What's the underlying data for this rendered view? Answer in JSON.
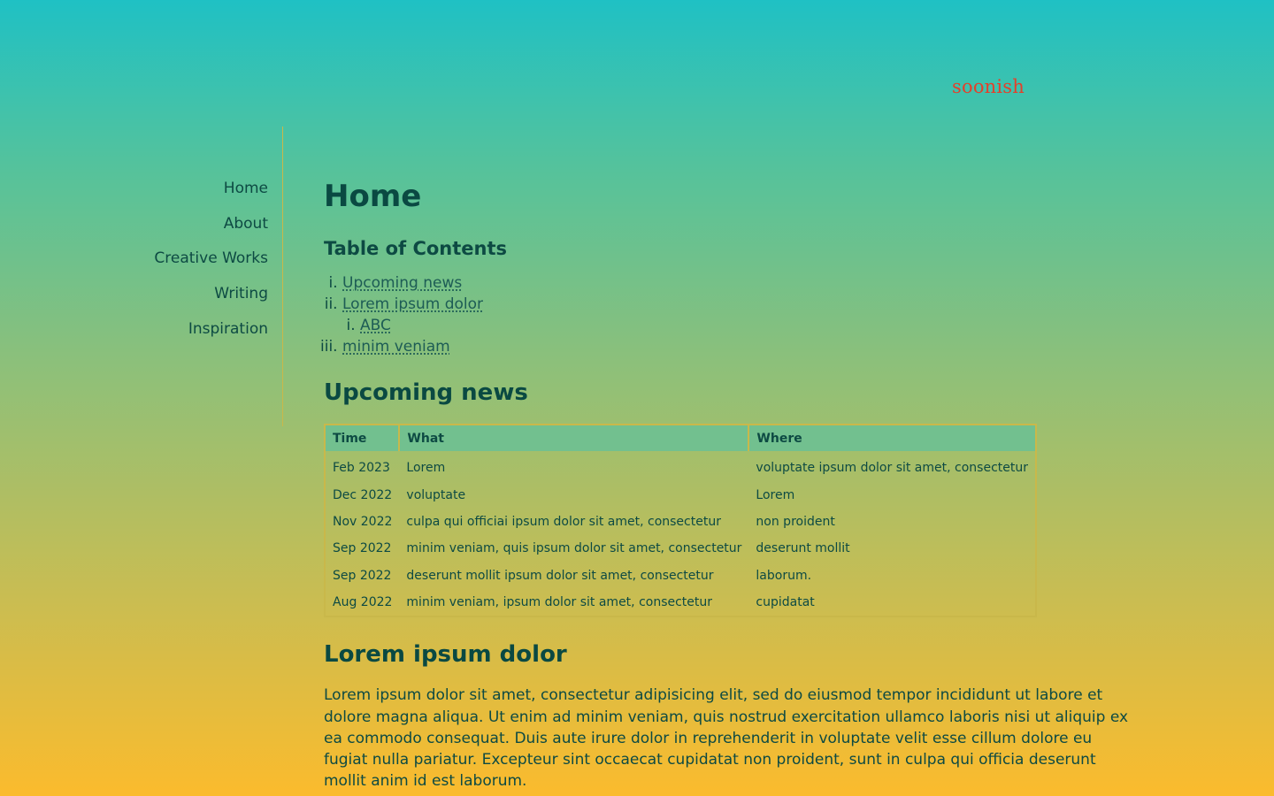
{
  "site": {
    "logo": "soonish"
  },
  "sidebar": {
    "items": [
      {
        "label": "Home"
      },
      {
        "label": "About"
      },
      {
        "label": "Creative Works"
      },
      {
        "label": "Writing"
      },
      {
        "label": "Inspiration"
      }
    ]
  },
  "main": {
    "title": "Home",
    "toc": {
      "title": "Table of Contents",
      "items": [
        {
          "label": "Upcoming news"
        },
        {
          "label": "Lorem ipsum dolor",
          "children": [
            {
              "label": "ABC"
            }
          ]
        },
        {
          "label": "minim veniam"
        }
      ]
    },
    "upcoming": {
      "heading": "Upcoming news",
      "columns": [
        "Time",
        "What",
        "Where"
      ],
      "rows": [
        [
          "Feb 2023",
          "Lorem",
          "voluptate ipsum dolor sit amet, consectetur"
        ],
        [
          "Dec 2022",
          "voluptate",
          "Lorem"
        ],
        [
          "Nov 2022",
          "culpa qui officiai ipsum dolor sit amet, consectetur",
          "non proident"
        ],
        [
          "Sep 2022",
          "minim veniam, quis ipsum dolor sit amet, consectetur",
          "deserunt mollit"
        ],
        [
          "Sep 2022",
          "deserunt mollit ipsum dolor sit amet, consectetur",
          "laborum."
        ],
        [
          "Aug 2022",
          "minim veniam, ipsum dolor sit amet, consectetur",
          "cupidatat"
        ]
      ]
    },
    "lorem": {
      "heading": "Lorem ipsum dolor",
      "paragraph": "Lorem ipsum dolor sit amet, consectetur adipisicing elit, sed do eiusmod tempor incididunt ut labore et dolore magna aliqua. Ut enim ad minim veniam, quis nostrud exercitation ullamco laboris nisi ut aliquip ex ea commodo consequat. Duis aute irure dolor in reprehenderit in voluptate velit esse cillum dolore eu fugiat nulla pariatur. Excepteur sint occaecat cupidatat non proident, sunt in culpa qui officia deserunt mollit anim id est laborum."
    }
  },
  "colors": {
    "gradient_top": "#1fc1c4",
    "gradient_bottom": "#fbbb2d",
    "text": "#0d4a43",
    "logo": "#e4402a",
    "table_header": "#72c08f",
    "border": "#c9b84a"
  }
}
